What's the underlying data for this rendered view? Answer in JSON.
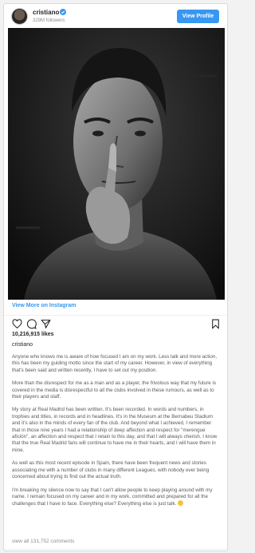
{
  "post": {
    "username": "cristiano",
    "followers": "329M followers",
    "view_profile_label": "View Profile",
    "view_more_label": "View More on Instagram",
    "likes": "10,216,915 likes",
    "caption_username": "cristiano",
    "caption_paragraphs": [
      "Anyone who knows me is aware of how focused I am on my work. Less talk and more action, this has been my guiding motto since the start of my career. However, in view of everything that's been said and written recently, I have to set out my position.",
      "More than the disrespect for me as a man and as a player, the frivolous way that my future is covered in the media is disrespectful to all the clubs involved in these rumours, as well as to their players and staff.",
      "My story at Real Madrid has been written. It's been recorded. In words and numbers, in trophies and titles, in records and in headlines. It's in the Museum at the Bernabeu Stadium and it's also in the minds of every fan of the club. And beyond what I achieved, I remember that in those nine years I had a relationship of deep affection and respect for \"merengue afición\", an affection and respect that I retain to this day, and that I will always cherish. I know that the true Real Madrid fans will continue to have me in their hearts, and I will have them in mine.",
      "As well as this most recent episode in Spain, there have been frequent news and stories associating me with a number of clubs in many different Leagues, with nobody ever being concerned about trying to find out the actual truth.",
      "I'm breaking my silence now to say that I can't allow people to keep playing around with my name. I remain focused on my career and in my work, committed and prepared for all the challenges that I have to face. Everything else? Everything else is just talk."
    ],
    "view_comments": "view all 131,752 comments"
  },
  "icons": {
    "verified": "verified-badge-icon",
    "like": "heart-icon",
    "comment": "comment-icon",
    "save": "bookmark-icon",
    "emoji": "smiling-face-emoji"
  },
  "colors": {
    "accent": "#3897f0",
    "text": "#262626",
    "muted": "#8e8e8e",
    "border": "#dbdbdb"
  }
}
